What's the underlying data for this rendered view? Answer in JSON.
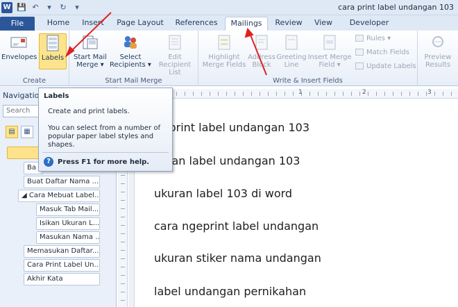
{
  "window": {
    "title": "cara print label undangan 103",
    "app_icon": "W"
  },
  "tabs": [
    {
      "label": "File"
    },
    {
      "label": "Home"
    },
    {
      "label": "Insert"
    },
    {
      "label": "Page Layout"
    },
    {
      "label": "References"
    },
    {
      "label": "Mailings"
    },
    {
      "label": "Review"
    },
    {
      "label": "View"
    },
    {
      "label": "Developer"
    }
  ],
  "ribbon": {
    "create": {
      "label": "Create",
      "envelopes": "Envelopes",
      "labels": "Labels"
    },
    "start_mail_merge": {
      "label": "Start Mail Merge",
      "start_mail": "Start Mail",
      "merge": "Merge",
      "select": "Select",
      "recipients": "Recipients",
      "edit": "Edit",
      "recipient_list": "Recipient List"
    },
    "write_insert": {
      "label": "Write & Insert Fields",
      "highlight": "Highlight",
      "merge_fields": "Merge Fields",
      "address": "Address",
      "block": "Block",
      "greeting": "Greeting",
      "line": "Line",
      "insert_merge": "Insert Merge",
      "field": "Field",
      "rules": "Rules",
      "match_fields": "Match Fields",
      "update_labels": "Update Labels"
    },
    "preview": {
      "preview": "Preview",
      "results": "Results"
    }
  },
  "tooltip": {
    "title": "Labels",
    "line1": "Create and print labels.",
    "line2": "You can select from a number of popular paper label styles and shapes.",
    "help": "Press F1 for more help."
  },
  "nav": {
    "title": "Navigation",
    "search_placeholder": "Search Do",
    "items": [
      {
        "label": ""
      },
      {
        "label": "Ba"
      },
      {
        "label": "Buat Daftar Nama ..."
      },
      {
        "label": "Cara Mebuat Label..."
      },
      {
        "label": "Masuk Tab Mail..."
      },
      {
        "label": "Isikan Ukuran L..."
      },
      {
        "label": "Masukan Nama ..."
      },
      {
        "label": "Memasukan Daftar..."
      },
      {
        "label": "Cara Print Label Un..."
      },
      {
        "label": "Akhir Kata"
      }
    ]
  },
  "ruler": {
    "n1": "1",
    "n2": "2",
    "n3": "3"
  },
  "document": {
    "lines": [
      "ra print label undangan 103",
      "kuran label undangan 103",
      "ukuran label 103 di word",
      "cara ngeprint label undangan",
      "ukuran stiker nama undangan",
      "label undangan pernikahan"
    ]
  },
  "colors": {
    "accent": "#2b579a",
    "annotation": "#e02020"
  }
}
